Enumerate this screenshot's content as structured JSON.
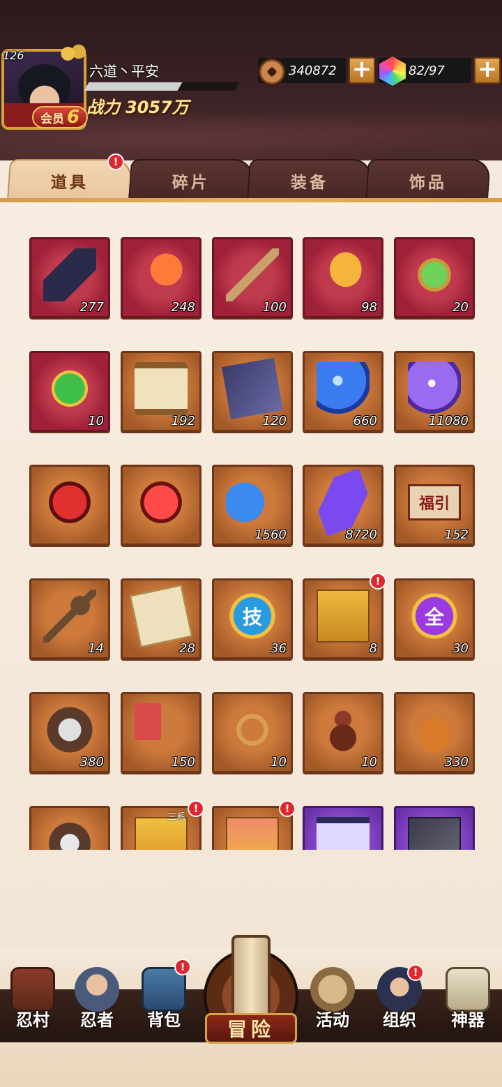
{
  "player": {
    "level": "126",
    "name": "六道丶平安",
    "vip_label": "会员",
    "vip_level": "6",
    "power_label": "战力",
    "power_value": "3057万",
    "name_bar_fill": 0.62
  },
  "currency": {
    "coins": "340872",
    "gems": "82/97",
    "plus": "+"
  },
  "tabs": [
    {
      "label": "道具",
      "active": true,
      "alert": "!"
    },
    {
      "label": "碎片",
      "active": false
    },
    {
      "label": "装备",
      "active": false
    },
    {
      "label": "饰品",
      "active": false
    }
  ],
  "items": [
    {
      "name": "scroll",
      "count": "277",
      "rarity": "red"
    },
    {
      "name": "red-feather",
      "count": "248",
      "rarity": "red"
    },
    {
      "name": "wooden-stick",
      "count": "100",
      "rarity": "red"
    },
    {
      "name": "golden-feather",
      "count": "98",
      "rarity": "red"
    },
    {
      "name": "green-amulet",
      "count": "20",
      "rarity": "red"
    },
    {
      "name": "green-gem",
      "count": "10",
      "rarity": "red"
    },
    {
      "name": "paper-scroll",
      "count": "192",
      "rarity": "brown"
    },
    {
      "name": "ninja-banner",
      "count": "120",
      "rarity": "brown"
    },
    {
      "name": "blue-orb",
      "count": "660",
      "rarity": "brown"
    },
    {
      "name": "purple-orb",
      "count": "11080",
      "rarity": "brown"
    },
    {
      "name": "red-stone",
      "count": "",
      "rarity": "brown"
    },
    {
      "name": "red-stone-bright",
      "count": "",
      "rarity": "brown"
    },
    {
      "name": "blue-moon",
      "count": "1560",
      "rarity": "brown"
    },
    {
      "name": "purple-crystal",
      "count": "8720",
      "rarity": "brown"
    },
    {
      "name": "fortune-ticket",
      "count": "152",
      "rarity": "brown",
      "label": "福引"
    },
    {
      "name": "key",
      "count": "14",
      "rarity": "brown"
    },
    {
      "name": "parchment",
      "count": "28",
      "rarity": "brown"
    },
    {
      "name": "skill-emblem",
      "count": "36",
      "rarity": "brown",
      "label": "技"
    },
    {
      "name": "gold-box",
      "count": "8",
      "rarity": "brown",
      "alert": "!"
    },
    {
      "name": "all-emblem",
      "count": "30",
      "rarity": "brown",
      "label": "全"
    },
    {
      "name": "shuriken-piece",
      "count": "380",
      "rarity": "brown"
    },
    {
      "name": "war-fan",
      "count": "150",
      "rarity": "brown"
    },
    {
      "name": "rope",
      "count": "10",
      "rarity": "brown"
    },
    {
      "name": "gourd",
      "count": "10",
      "rarity": "brown"
    },
    {
      "name": "sake-jar",
      "count": "330",
      "rarity": "brown"
    },
    {
      "name": "violin-piece",
      "count": "",
      "rarity": "brown"
    },
    {
      "name": "gift-box-gold",
      "count": "",
      "rarity": "brown",
      "alert": "!",
      "tag": "三系"
    },
    {
      "name": "gift-box-red",
      "count": "",
      "rarity": "brown",
      "alert": "!"
    },
    {
      "name": "purple-scroll",
      "count": "",
      "rarity": "purple"
    },
    {
      "name": "skill-book",
      "count": "",
      "rarity": "purple"
    }
  ],
  "nav": [
    {
      "label": "忍村",
      "icon": "village-gate-icon",
      "alert": ""
    },
    {
      "label": "忍者",
      "icon": "ninja-icon",
      "alert": ""
    },
    {
      "label": "背包",
      "icon": "backpack-icon",
      "alert": "!"
    },
    {
      "label": "冒险",
      "icon": "adventure-scroll-icon",
      "alert": ""
    },
    {
      "label": "活动",
      "icon": "shuriken-drum-icon",
      "alert": ""
    },
    {
      "label": "组织",
      "icon": "organization-icon",
      "alert": "!"
    },
    {
      "label": "神器",
      "icon": "artifact-book-icon",
      "alert": ""
    }
  ],
  "colors": {
    "header_bg": "#2b1a1a",
    "tab_active": "#f1d6b2",
    "tab_inactive": "#5a3531",
    "item_red": "#9e2138",
    "item_brown": "#a45a28",
    "item_purple": "#6a2fa6",
    "alert_red": "#e2262e",
    "accent_gold": "#d69a49"
  }
}
